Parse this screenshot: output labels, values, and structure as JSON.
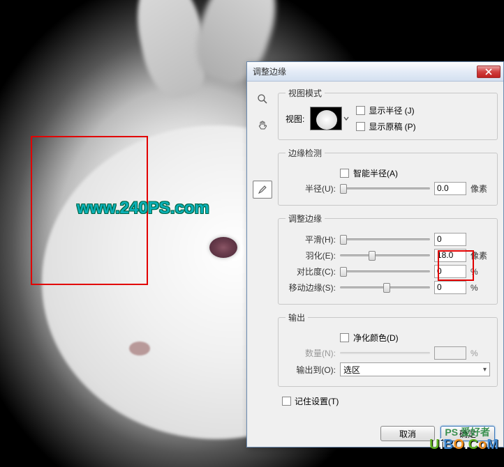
{
  "dialog": {
    "title": "调整边缘"
  },
  "view_mode": {
    "legend": "视图模式",
    "view_label": "视图:",
    "show_radius": "显示半径 (J)",
    "show_original": "显示原稿 (P)"
  },
  "edge_detection": {
    "legend": "边缘检测",
    "smart_radius": "智能半径(A)",
    "radius_label": "半径(U):",
    "radius_value": "0.0",
    "radius_unit": "像素"
  },
  "adjust_edge": {
    "legend": "调整边缘",
    "smooth_label": "平滑(H):",
    "smooth_value": "0",
    "feather_label": "羽化(E):",
    "feather_value": "18.0",
    "feather_unit": "像素",
    "contrast_label": "对比度(C):",
    "contrast_value": "0",
    "contrast_unit": "%",
    "shift_label": "移动边缘(S):",
    "shift_value": "0",
    "shift_unit": "%"
  },
  "output": {
    "legend": "输出",
    "decontaminate": "净化颜色(D)",
    "amount_label": "数量(N):",
    "amount_unit": "%",
    "output_to_label": "输出到(O):",
    "output_to_value": "选区"
  },
  "remember": "记住设置(T)",
  "buttons": {
    "cancel": "取消",
    "ok": "确定"
  },
  "watermarks": {
    "w1": "www.240PS.com",
    "ps": "PS 爱好者"
  }
}
